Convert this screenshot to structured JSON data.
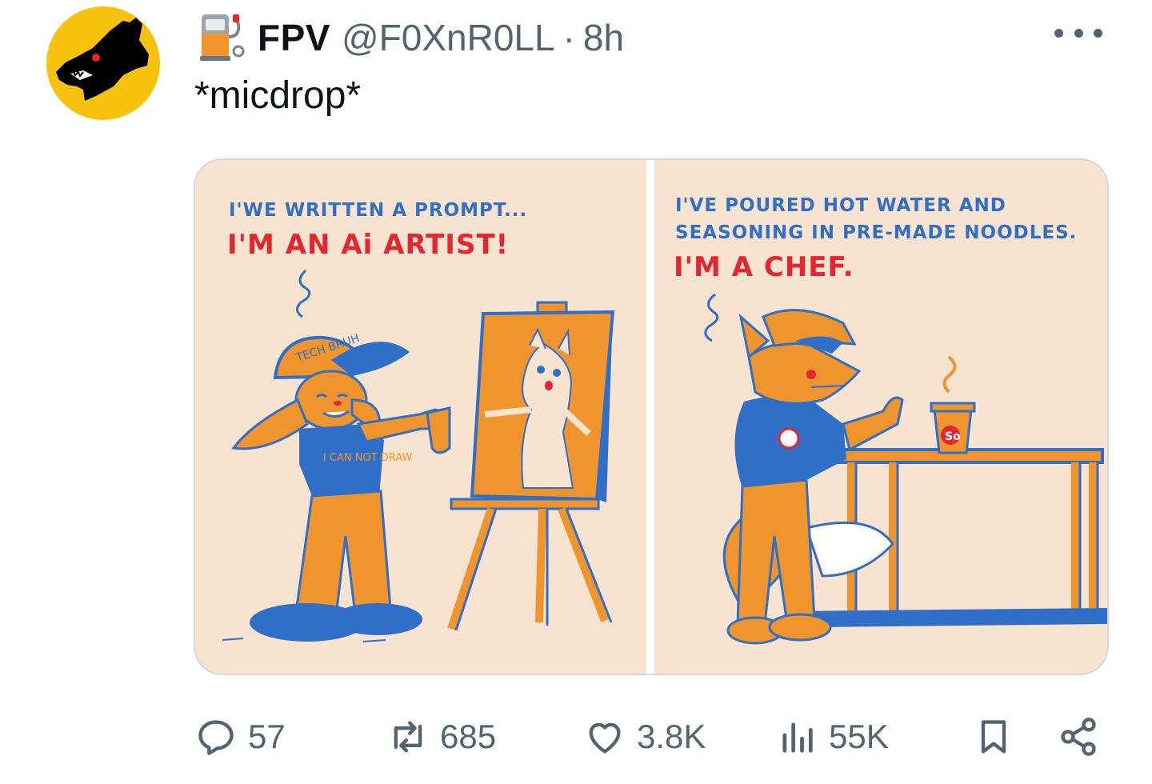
{
  "author": {
    "name": "FPV",
    "handle": "@F0XnR0LL",
    "separator": "·",
    "time": "8h",
    "avatar_icon": "wolf-avatar-icon",
    "badge_icon": "fuel-pump-icon"
  },
  "tweet": {
    "text": "*micdrop*"
  },
  "comic": {
    "left": {
      "line1": "I'WE WRITTEN A PROMPT...",
      "line2": "I'M AN Ai ARTIST!",
      "cap_text": "TECH BRUH",
      "shirt_text": "I CAN NOT DRAW"
    },
    "right": {
      "line1": "I'VE POURED HOT WATER AND",
      "line2": "SEASONING IN PRE-MADE NOODLES.",
      "line3": "I'M A CHEF.",
      "cup_text": "So"
    }
  },
  "actions": {
    "replies": "57",
    "reposts": "685",
    "likes": "3.8K",
    "views": "55K"
  },
  "colors": {
    "avatar_bg": "#f7c20d",
    "comic_bg": "#f7e3cf",
    "comic_blue": "#2f6fc7",
    "comic_orange": "#f0952e",
    "comic_red": "#e32630",
    "muted": "#536471"
  }
}
